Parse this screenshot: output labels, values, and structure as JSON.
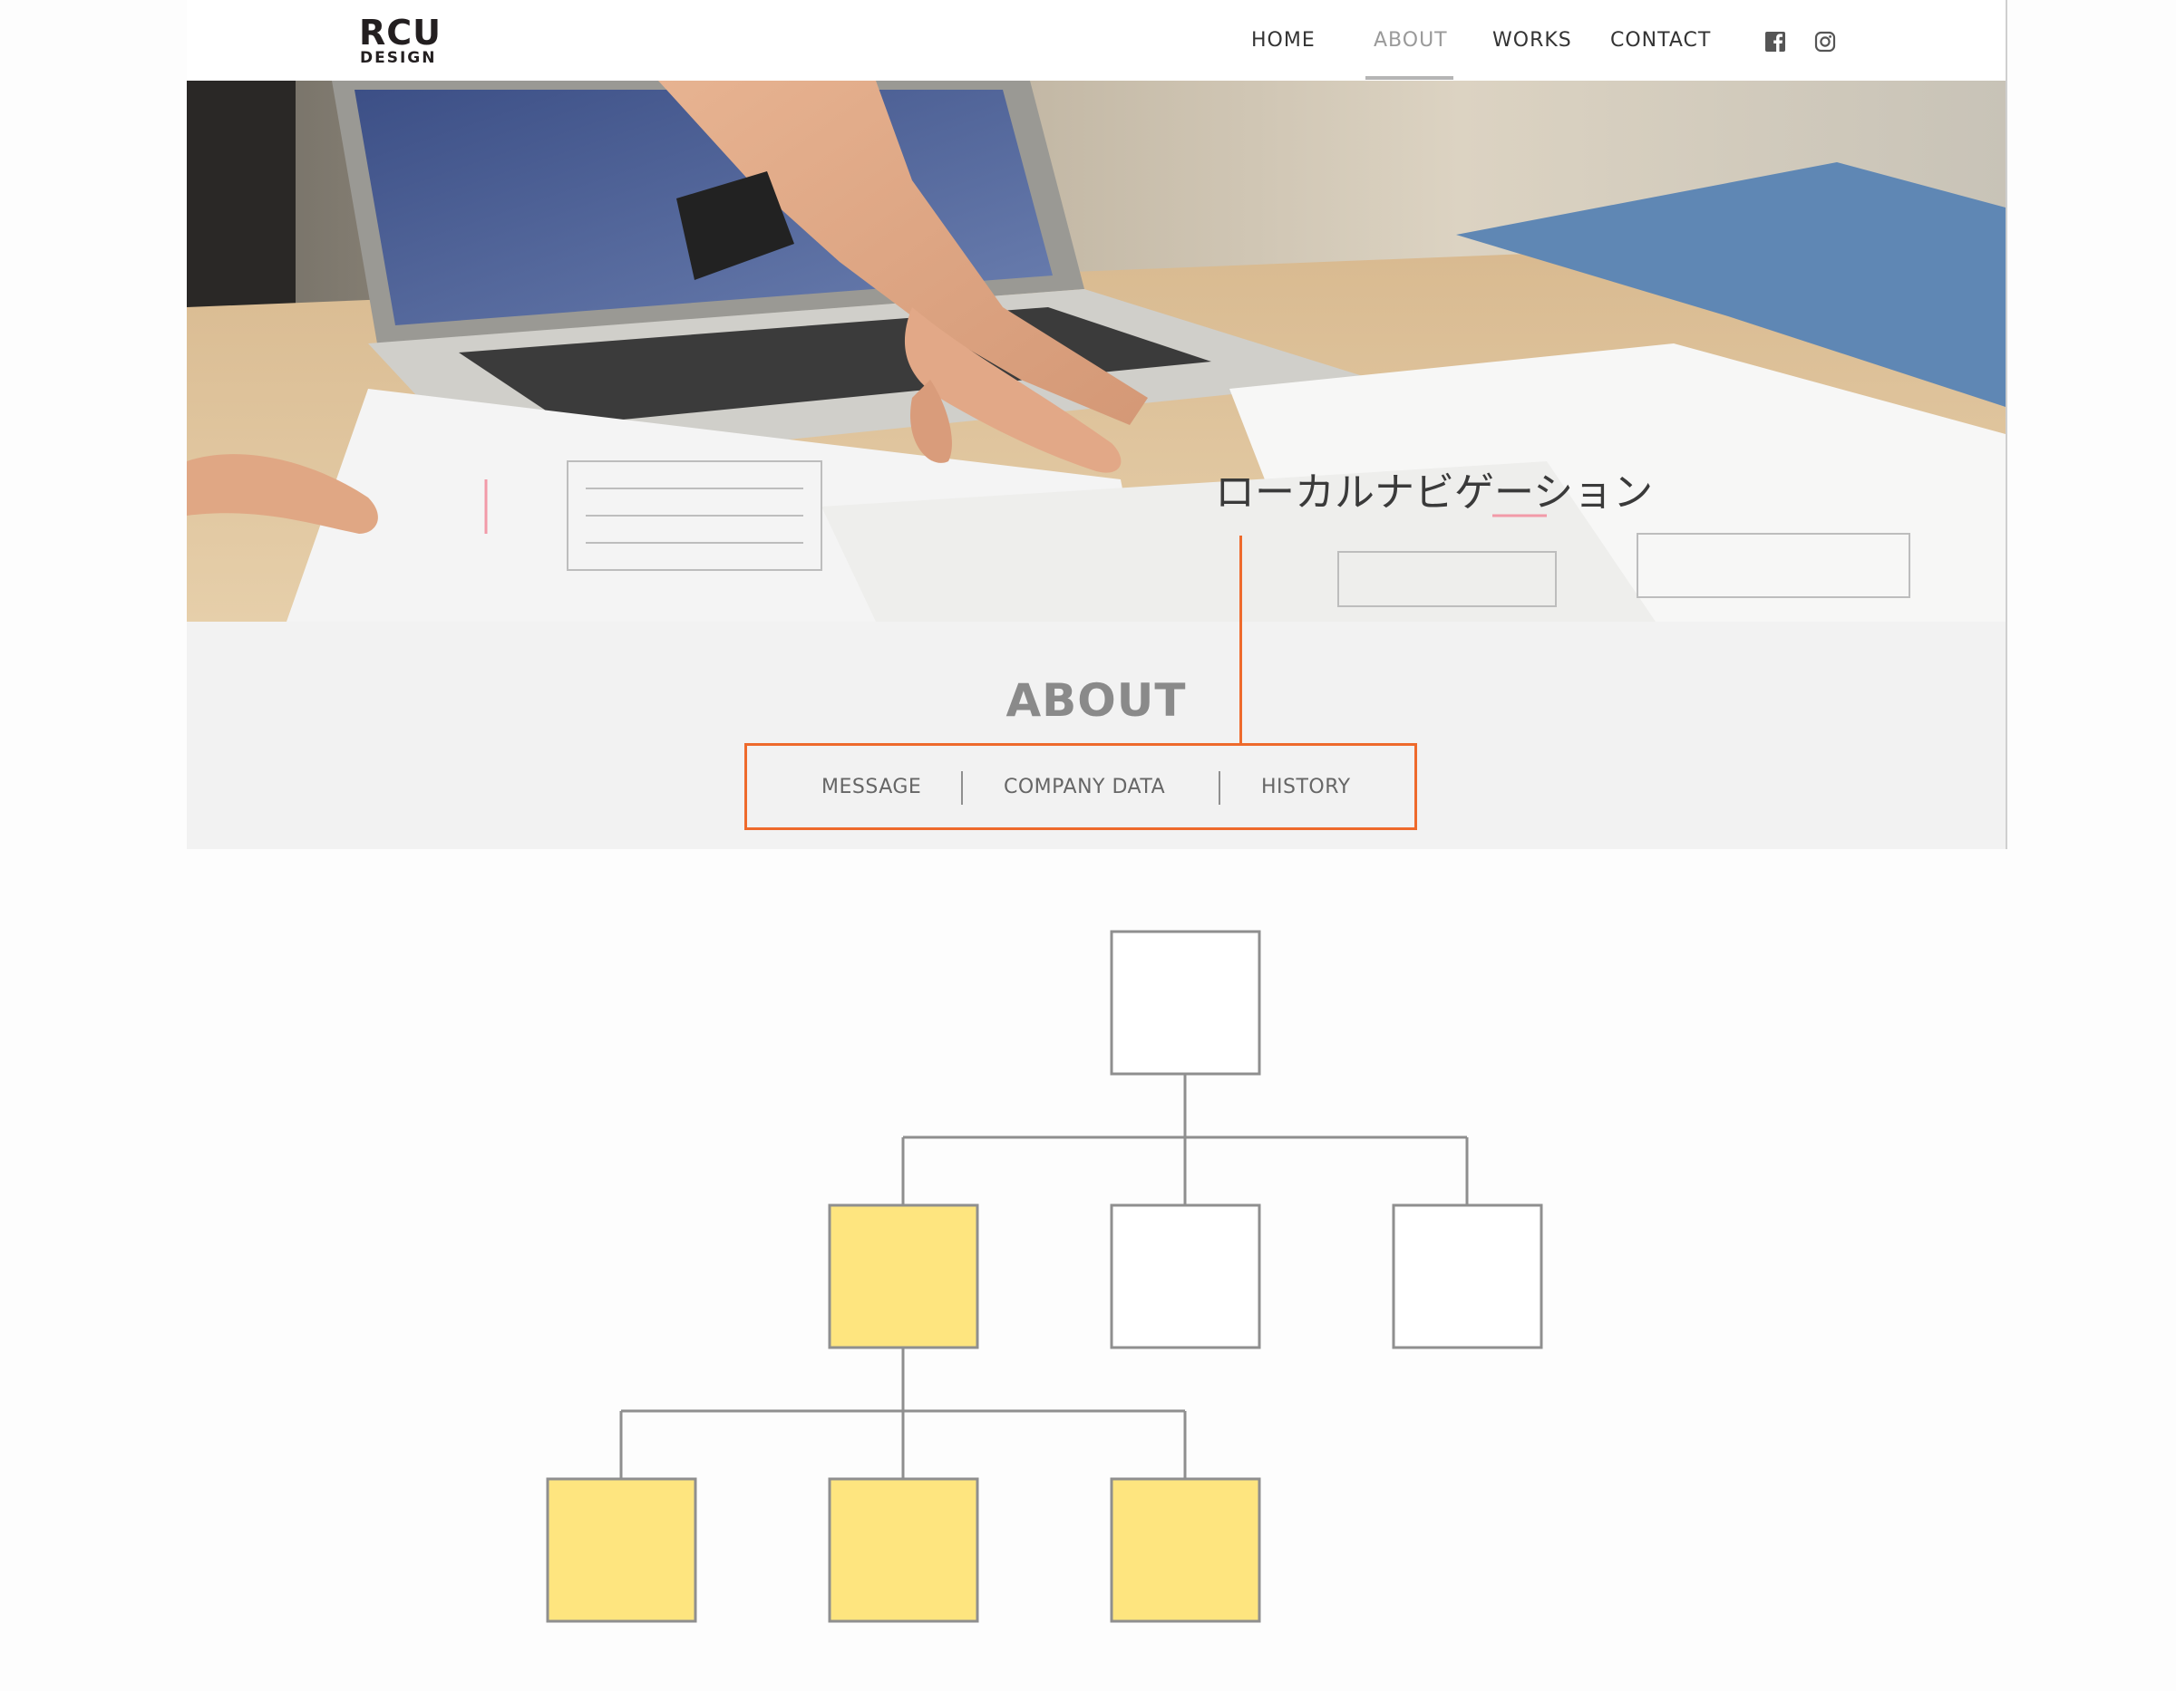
{
  "site": {
    "logo": {
      "main": "RCU",
      "sub": "DESIGN"
    },
    "nav": [
      {
        "label": "HOME",
        "active": false
      },
      {
        "label": "ABOUT",
        "active": true
      },
      {
        "label": "WORKS",
        "active": false
      },
      {
        "label": "CONTACT",
        "active": false
      }
    ],
    "social": [
      "facebook-icon",
      "instagram-icon"
    ]
  },
  "about": {
    "title": "ABOUT",
    "local_nav": [
      "MESSAGE",
      "COMPANY DATA",
      "HISTORY"
    ]
  },
  "annotation": {
    "label": "ローカルナビゲーション"
  },
  "colors": {
    "highlight": "#ee6a2c",
    "node_highlight": "#fee57f",
    "node_plain": "#ffffff",
    "connector": "#8f8f8f"
  },
  "tree": {
    "root": {
      "highlighted": false
    },
    "level2": [
      {
        "highlighted": true
      },
      {
        "highlighted": false
      },
      {
        "highlighted": false
      }
    ],
    "level3": [
      {
        "highlighted": true
      },
      {
        "highlighted": true
      },
      {
        "highlighted": true
      }
    ]
  }
}
